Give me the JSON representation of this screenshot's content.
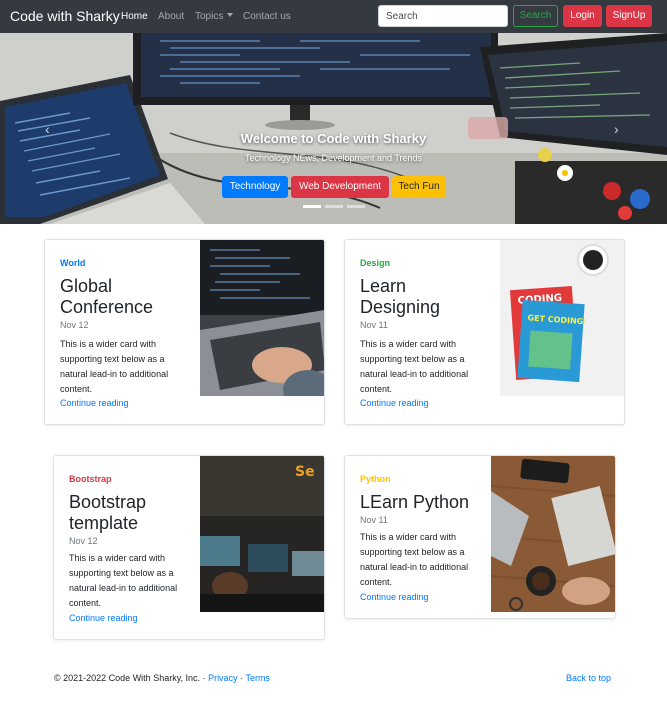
{
  "navbar": {
    "brand": "Code with Sharky",
    "links": {
      "home": "Home",
      "about": "About",
      "topics": "Topics",
      "contact": "Contact us"
    },
    "search_placeholder": "Search",
    "search_button": "Search",
    "login_button": "Login",
    "signup_button": "SignUp"
  },
  "hero": {
    "title": "Welcome to Code with Sharky",
    "subtitle": "Technology NEws, Development and Trends",
    "buttons": {
      "technology": "Technology",
      "web": "Web Development",
      "fun": "Tech Fun"
    },
    "prev_icon": "‹",
    "next_icon": "›"
  },
  "cards": [
    {
      "category": "World",
      "category_color": "#007bff",
      "title": "Global Conference",
      "date": "Nov 12",
      "text": "This is a wider card with supporting text below as a natural lead-in to additional content.",
      "link": "Continue reading"
    },
    {
      "category": "Design",
      "category_color": "#28a745",
      "title": "Learn Designing",
      "date": "Nov 11",
      "text": "This is a wider card with supporting text below as a natural lead-in to additional content.",
      "link": "Continue reading"
    },
    {
      "category": "Bootstrap",
      "category_color": "#dc3545",
      "title": "Bootstrap template",
      "date": "Nov 12",
      "text": "This is a wider card with supporting text below as a natural lead-in to additional content.",
      "link": "Continue reading"
    },
    {
      "category": "Python",
      "category_color": "#ffc107",
      "title": "LEarn Python",
      "date": "Nov 11",
      "text": "This is a wider card with supporting text below as a natural lead-in to additional content.",
      "link": "Continue reading"
    }
  ],
  "footer": {
    "copyright": "© 2021-2022 Code With Sharky, Inc. ·",
    "privacy": "Privacy",
    "separator": "·",
    "terms": "Terms",
    "back_to_top": "Back to top"
  },
  "book_cover": {
    "top": "CODING",
    "main": "GET CODING!"
  }
}
